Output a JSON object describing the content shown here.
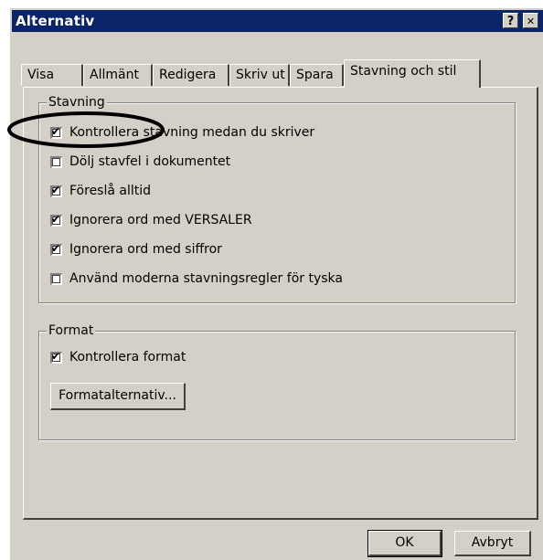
{
  "window": {
    "title": "Alternativ",
    "help_label": "?",
    "close_label": "✕"
  },
  "tabs": [
    {
      "label": "Visa",
      "active": false
    },
    {
      "label": "Allmänt",
      "active": false
    },
    {
      "label": "Redigera",
      "active": false
    },
    {
      "label": "Skriv ut",
      "active": false
    },
    {
      "label": "Spara",
      "active": false
    },
    {
      "label": "Stavning och stil",
      "active": true
    }
  ],
  "spelling_group": {
    "label": "Stavning",
    "options": [
      {
        "label": "Kontrollera stavning medan du skriver",
        "checked": true
      },
      {
        "label": "Dölj stavfel i dokumentet",
        "checked": false
      },
      {
        "label": "Föreslå alltid",
        "checked": true
      },
      {
        "label": "Ignorera ord med VERSALER",
        "checked": true
      },
      {
        "label": "Ignorera ord med siffror",
        "checked": true
      },
      {
        "label": "Använd moderna stavningsregler för tyska",
        "checked": false
      }
    ]
  },
  "format_group": {
    "label": "Format",
    "check_format": {
      "label": "Kontrollera format",
      "checked": true
    },
    "options_button": "Formatalternativ..."
  },
  "buttons": {
    "ok": "OK",
    "cancel": "Avbryt"
  },
  "colors": {
    "titlebar": "#0a246a",
    "face": "#d4d0c8"
  }
}
